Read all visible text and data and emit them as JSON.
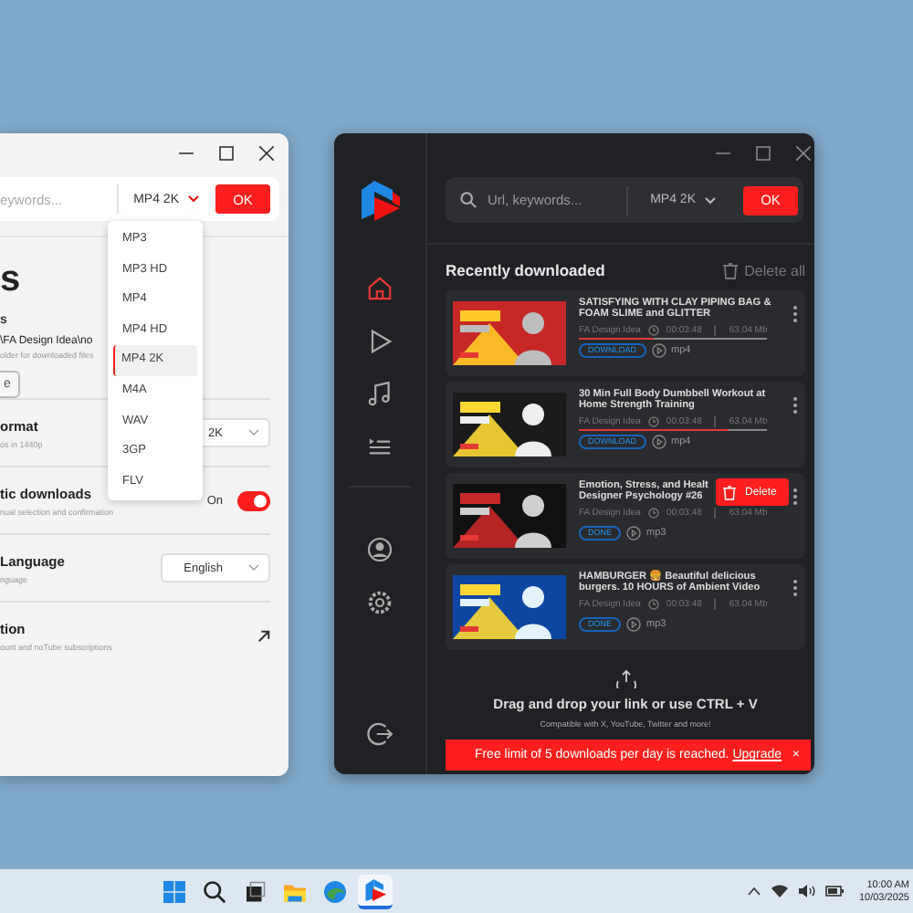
{
  "settings_window": {
    "search": {
      "placeholder": "eywords..."
    },
    "format": "MP4 2K",
    "ok": "OK",
    "title": "s",
    "folder": {
      "label": "s",
      "path": "\\FA Design Idea\\no",
      "hint": "older for downloaded files",
      "button": "e"
    },
    "rows": [
      {
        "kind": "select",
        "title": "ormat",
        "subtitle": "os in 1440p",
        "value": "2K"
      },
      {
        "kind": "toggle",
        "title": "tic downloads",
        "subtitle": "nual selection and confirmation",
        "value": "On",
        "on": true
      },
      {
        "kind": "select",
        "title": "Language",
        "subtitle": "nguage",
        "value": "English"
      },
      {
        "kind": "link",
        "title": "tion",
        "subtitle": "ount and noTube subscriptions"
      }
    ],
    "dropdown": [
      {
        "label": "MP3",
        "selected": false
      },
      {
        "label": "MP3 HD",
        "selected": false
      },
      {
        "label": "MP4",
        "selected": false
      },
      {
        "label": "MP4 HD",
        "selected": false
      },
      {
        "label": "MP4 2K",
        "selected": true
      },
      {
        "label": "M4A",
        "selected": false
      },
      {
        "label": "WAV",
        "selected": false
      },
      {
        "label": "3GP",
        "selected": false
      },
      {
        "label": "FLV",
        "selected": false
      }
    ]
  },
  "main_window": {
    "search": {
      "placeholder": "Url, keywords..."
    },
    "format": "MP4 2K",
    "ok": "OK",
    "sidebar": [
      {
        "kind": "home",
        "selected": true
      },
      {
        "kind": "play",
        "selected": false
      },
      {
        "kind": "music",
        "selected": false
      },
      {
        "kind": "playlist",
        "selected": false
      },
      {
        "kind": "user",
        "selected": false
      },
      {
        "kind": "settings",
        "selected": false
      },
      {
        "kind": "logout",
        "selected": false
      }
    ],
    "section_title": "Recently downloaded",
    "delete_all": "Delete all",
    "items": [
      {
        "kind": "picture",
        "title": "SATISFYING WITH CLAY PIPING BAG & FOAM SLIME and GLITTER",
        "channel": "FA Design Idea",
        "duration": "00:03:48",
        "size": "63.04 Mb",
        "status": "DOWNLOAD",
        "format": "mp4",
        "level": 0.4
      },
      {
        "kind": "picture",
        "title": "30 Min Full Body Dumbbell Workout at Home Strength Training",
        "channel": "FA Design Idea",
        "duration": "00:03:48",
        "size": "63.04 Mb",
        "status": "DOWNLOAD",
        "format": "mp4",
        "level": 0.8
      },
      {
        "kind": "picture",
        "title": "Emotion, Stress, and Healt Designer Psychology #26",
        "channel": "FA Design Idea",
        "duration": "00:03:48",
        "size": "63.04 Mb",
        "status": "DONE",
        "format": "mp3",
        "menu": "Delete"
      },
      {
        "kind": "picture",
        "title": "HAMBURGER 🍔 Beautiful delicious burgers. 10 HOURS of Ambient Video",
        "channel": "FA Design Idea",
        "duration": "00:03:48",
        "size": "63.04 Mb",
        "status": "DONE",
        "format": "mp3"
      }
    ],
    "drop": {
      "text": "Drag and drop your link or use CTRL + V",
      "subtext": "Compatible with X, YouTube, Twitter and more!"
    },
    "banner": {
      "text": "Free limit of 5 downloads per day is reached.",
      "link": "Upgrade",
      "close": "×"
    }
  },
  "taskbar": {
    "apps": [
      {
        "kind": "start",
        "active": false
      },
      {
        "kind": "search",
        "active": false
      },
      {
        "kind": "taskview",
        "active": false
      },
      {
        "kind": "folder",
        "active": false
      },
      {
        "kind": "browser",
        "active": false
      },
      {
        "kind": "app",
        "active": true
      }
    ],
    "time": "10:00 AM",
    "date": "10/03/2025"
  }
}
